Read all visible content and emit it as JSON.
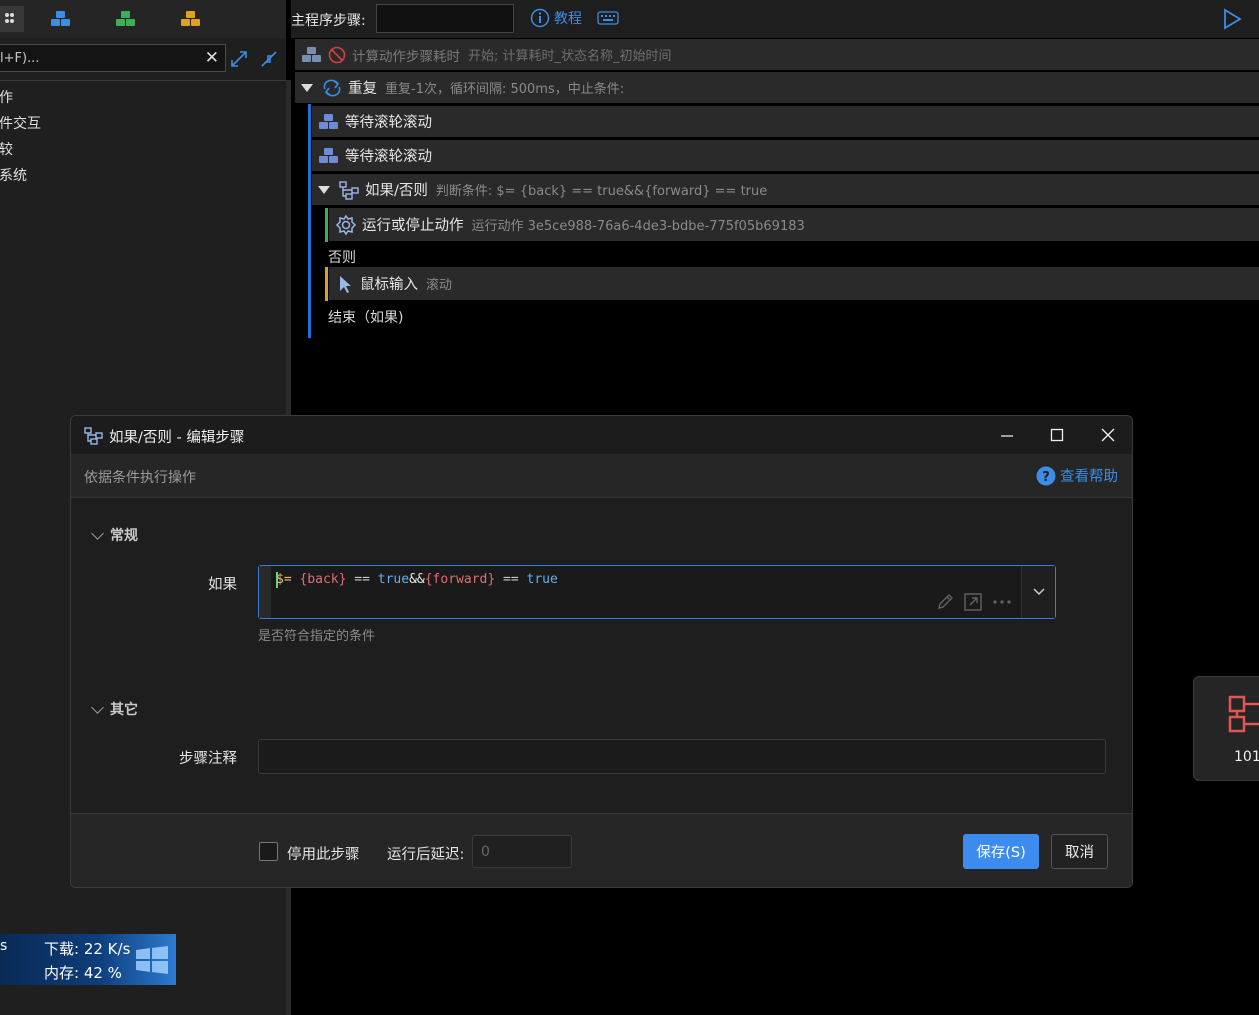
{
  "left_panel": {
    "search_placeholder": "l+F)...",
    "tree": [
      "作",
      "件交互",
      "较",
      "系统"
    ],
    "net": {
      "download": "下载: 22 K/s",
      "memory": "内存: 42 %"
    }
  },
  "top_bar": {
    "main_steps_label": "主程序步骤:",
    "tutorial": "教程"
  },
  "steps": {
    "s1": {
      "name": "计算动作步骤耗时",
      "desc": "开始; 计算耗时_状态名称_初始时间"
    },
    "s2": {
      "name": "重复",
      "desc": "重复-1次，循环间隔: 500ms，中止条件:"
    },
    "s3": {
      "name": "等待滚轮滚动"
    },
    "s4": {
      "name": "等待滚轮滚动"
    },
    "s5": {
      "name": "如果/否则",
      "desc": "判断条件: $= {back} == true&&{forward} == true"
    },
    "s6": {
      "name": "运行或停止动作",
      "desc": "运行动作 3e5ce988-76a6-4de3-bdbe-775f05b69183"
    },
    "else_label": "否则",
    "s7": {
      "name": "鼠标输入",
      "desc": "滚动"
    },
    "end_label": "结束（如果)"
  },
  "mini_panel": {
    "number": "101"
  },
  "dialog": {
    "title": "如果/否则  -  编辑步骤",
    "description": "依据条件执行操作",
    "help": "查看帮助",
    "section_general": "常规",
    "if_label": "如果",
    "condition": {
      "dollar": "$=",
      "var1": "{back}",
      "op1": "==",
      "val1": "true",
      "and": "&&",
      "var2": "{forward}",
      "op2": "==",
      "val2": "true"
    },
    "condition_hint": "是否符合指定的条件",
    "section_other": "其它",
    "note_label": "步骤注释",
    "note_value": "",
    "disable_label": "停用此步骤",
    "delay_label": "运行后延迟:",
    "delay_value": "0",
    "save": "保存(S)",
    "cancel": "取消"
  },
  "colors": {
    "accent": "#3a8ee6",
    "save_button": "#3c8cf0",
    "block_blue": "#1e6fd9",
    "block_green": "#3fae5a",
    "block_orange": "#e0a020",
    "code_var": "#e06c75",
    "code_bool": "#61afef"
  }
}
